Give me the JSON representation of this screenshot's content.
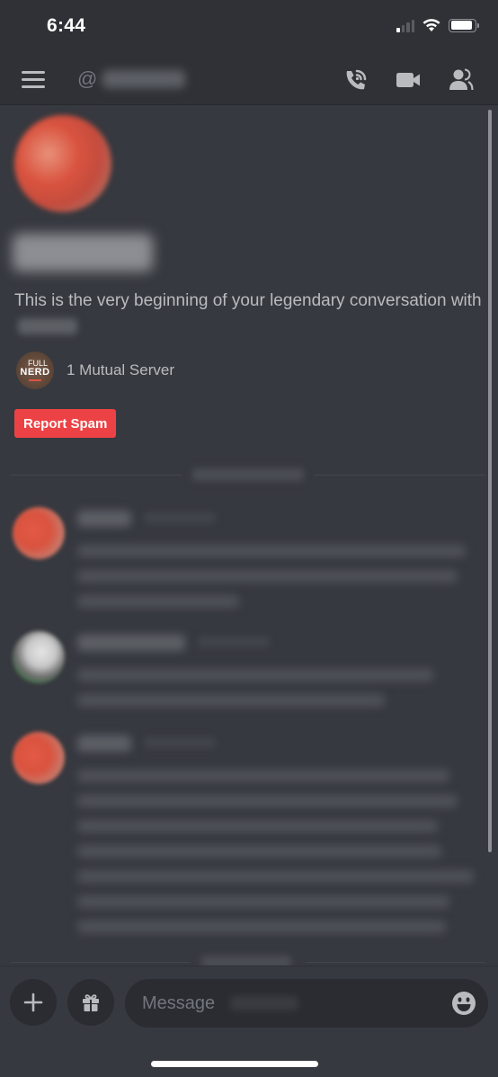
{
  "status_bar": {
    "time": "6:44",
    "signal_bars_active": 1,
    "signal_bars_total": 4,
    "battery_level": 0.9
  },
  "header": {
    "at_symbol": "@",
    "recipient_name_redacted": true,
    "icons": [
      "hamburger-menu-icon",
      "voice-call-icon",
      "video-call-icon",
      "members-icon"
    ]
  },
  "profile": {
    "username_redacted": true,
    "intro_text": "This is the very beginning of your legendary conversation with",
    "mutual_server": {
      "icon_line1": "FULL",
      "icon_line2": "NERD",
      "label": "1 Mutual Server"
    },
    "report_spam_label": "Report Spam"
  },
  "conversation": {
    "date_dividers_redacted": true,
    "messages": [
      {
        "avatar": "red",
        "redacted": true,
        "line_count": 3
      },
      {
        "avatar": "green",
        "redacted": true,
        "line_count": 2
      },
      {
        "avatar": "red",
        "redacted": true,
        "line_count": 7
      }
    ]
  },
  "composer": {
    "placeholder": "Message",
    "value": ""
  },
  "colors": {
    "background": "#36393f",
    "header": "#2f3136",
    "danger": "#ed4245",
    "muted_text": "#b9bbbe"
  }
}
